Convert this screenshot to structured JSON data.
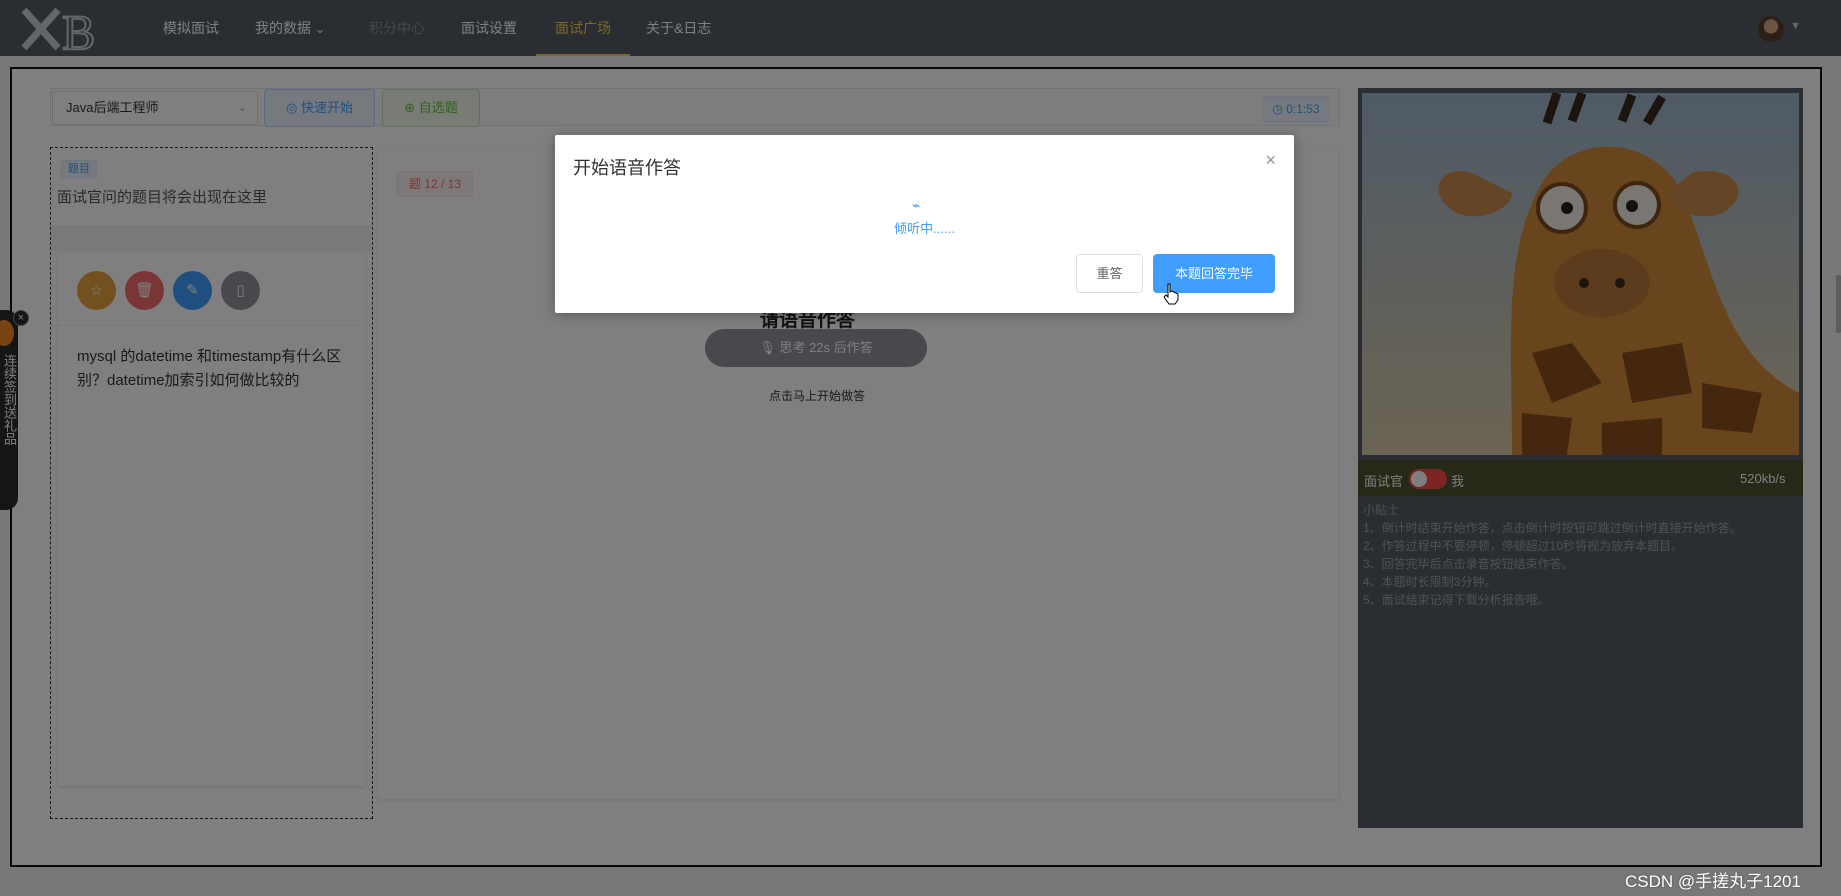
{
  "nav": {
    "logo": "XB",
    "items": [
      {
        "label": "模拟面试"
      },
      {
        "label": "我的数据"
      },
      {
        "label": "积分中心"
      },
      {
        "label": "面试设置"
      },
      {
        "label": "面试广场"
      },
      {
        "label": "关于&日志"
      }
    ]
  },
  "toolbar": {
    "job_select": "Java后端工程师",
    "quick_start": "快速开始",
    "custom_pick": "自选题",
    "timer": "0:1:53"
  },
  "question_panel": {
    "tag": "题目",
    "hint": "面试官问的题目将会出现在这里",
    "question": "mysql 的datetime 和timestamp有什么区别？datetime加索引如何做比较的"
  },
  "answer_panel": {
    "progress": "题 12 / 13",
    "title": "请语音作答",
    "think": "思考 22s 后作答",
    "start_hint": "点击马上开始做答"
  },
  "video_panel": {
    "interviewer": "面试官",
    "me": "我",
    "speed": "520kb/s",
    "tips_title": "小贴士",
    "tips": [
      "1、倒计时结束开始作答，点击倒计时按钮可跳过倒计时直接开始作答。",
      "2、作答过程中不要停顿，停顿超过10秒将视为放弃本题目。",
      "3、回答完毕后点击录音按钮结束作答。",
      "4、本题时长限制3分钟。",
      "5、面试结束记得下载分析报告哦。"
    ]
  },
  "side_widget": {
    "text": "连续签到送礼品"
  },
  "dialog": {
    "title": "开始语音作答",
    "status": "倾听中......",
    "reset": "重答",
    "done": "本题回答完毕"
  },
  "watermark": "CSDN @手搓丸子1201",
  "colors": {
    "accent": "#409eff",
    "nav_bg": "#545c64",
    "nav_active": "#ffd04b",
    "danger": "#f56c6c",
    "warning": "#e6a23c"
  }
}
